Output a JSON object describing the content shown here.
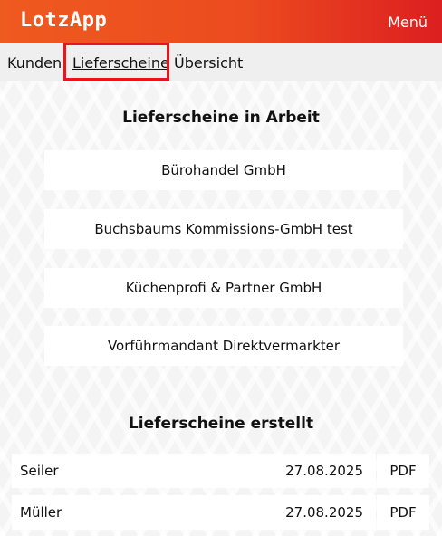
{
  "header": {
    "app_title": "LotzApp",
    "menu_label": "Menü"
  },
  "nav": {
    "tabs": [
      {
        "label": "Kunden"
      },
      {
        "label": "Lieferscheine",
        "active": true
      },
      {
        "label": "Übersicht"
      }
    ]
  },
  "in_progress": {
    "title": "Lieferscheine in Arbeit",
    "items": [
      {
        "label": "Bürohandel GmbH"
      },
      {
        "label": "Buchsbaums Kommissions-GmbH test"
      },
      {
        "label": "Küchenprofi & Partner GmbH"
      },
      {
        "label": "Vorführmandant Direktvermarkter"
      }
    ]
  },
  "created": {
    "title": "Lieferscheine erstellt",
    "rows": [
      {
        "name": "Seiler",
        "date": "27.08.2025",
        "pdf_label": "PDF"
      },
      {
        "name": "Müller",
        "date": "27.08.2025",
        "pdf_label": "PDF"
      }
    ]
  },
  "colors": {
    "header_start": "#ef5a1f",
    "header_end": "#dc1f20",
    "highlight": "#e8161c"
  }
}
